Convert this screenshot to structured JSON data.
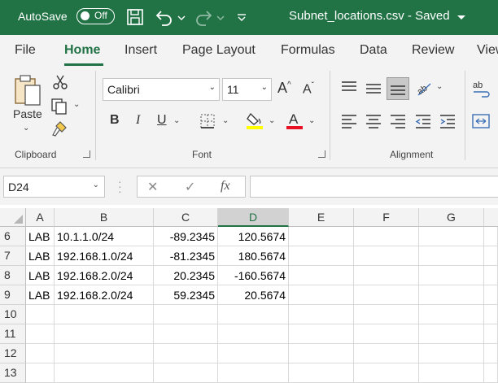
{
  "titlebar": {
    "autosave_label": "AutoSave",
    "autosave_state": "Off",
    "document_title": "Subnet_locations.csv  -  Saved"
  },
  "tabs": [
    "File",
    "Home",
    "Insert",
    "Page Layout",
    "Formulas",
    "Data",
    "Review",
    "View"
  ],
  "active_tab": "Home",
  "ribbon": {
    "clipboard": {
      "paste_label": "Paste",
      "group_label": "Clipboard"
    },
    "font": {
      "font_name": "Calibri",
      "font_size": "11",
      "bold": "B",
      "italic": "I",
      "underline": "U",
      "group_label": "Font",
      "fill_color": "#ffff00",
      "font_color": "#e81123"
    },
    "alignment": {
      "group_label": "Alignment"
    }
  },
  "formula_bar": {
    "name_box": "D24",
    "fx_symbol": "fx",
    "formula": ""
  },
  "grid": {
    "columns": [
      "A",
      "B",
      "C",
      "D",
      "E",
      "F",
      "G"
    ],
    "selected_column": "D",
    "rows": [
      {
        "num": "6",
        "cells": [
          "LAB",
          "10.1.1.0/24",
          "-89.2345",
          "120.5674"
        ]
      },
      {
        "num": "7",
        "cells": [
          "LAB",
          "192.168.1.0/24",
          "-81.2345",
          "180.5674"
        ]
      },
      {
        "num": "8",
        "cells": [
          "LAB",
          "192.168.2.0/24",
          "20.2345",
          "-160.5674"
        ]
      },
      {
        "num": "9",
        "cells": [
          "LAB",
          "192.168.2.0/24",
          "59.2345",
          "20.5674"
        ]
      },
      {
        "num": "10",
        "cells": [
          "",
          "",
          "",
          ""
        ]
      },
      {
        "num": "11",
        "cells": [
          "",
          "",
          "",
          ""
        ]
      },
      {
        "num": "12",
        "cells": [
          "",
          "",
          "",
          ""
        ]
      },
      {
        "num": "13",
        "cells": [
          "",
          "",
          "",
          ""
        ]
      }
    ]
  },
  "colors": {
    "accent": "#217346"
  }
}
